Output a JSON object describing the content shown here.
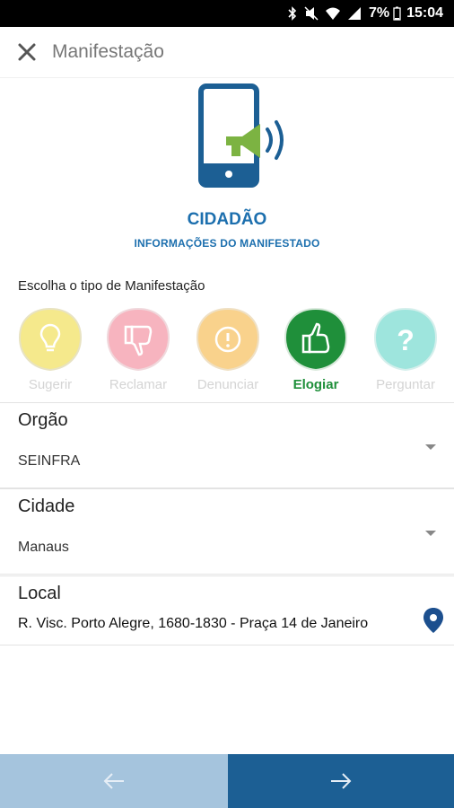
{
  "statusbar": {
    "battery": "7%",
    "time": "15:04"
  },
  "appbar": {
    "title": "Manifestação"
  },
  "hero": {
    "title": "CIDADÃO",
    "subtitle": "INFORMAÇÕES DO MANIFESTADO"
  },
  "types": {
    "prompt": "Escolha o tipo de Manifestação",
    "items": [
      {
        "label": "Sugerir",
        "icon": "lightbulb-icon",
        "color": "#f5e98c",
        "selected": false
      },
      {
        "label": "Reclamar",
        "icon": "thumbs-down-icon",
        "color": "#f7b4bf",
        "selected": false
      },
      {
        "label": "Denunciar",
        "icon": "exclamation-icon",
        "color": "#f9d28c",
        "selected": false
      },
      {
        "label": "Elogiar",
        "icon": "thumbs-up-icon",
        "color": "#1f8f3a",
        "selected": true
      },
      {
        "label": "Perguntar",
        "icon": "question-icon",
        "color": "#9ee5dd",
        "selected": false
      }
    ]
  },
  "orgao": {
    "label": "Orgão",
    "value": "SEINFRA"
  },
  "cidade": {
    "label": "Cidade",
    "value": "Manaus"
  },
  "local": {
    "label": "Local",
    "value": "R. Visc. Porto Alegre, 1680-1830 - Praça 14 de Janeiro"
  },
  "colors": {
    "primary": "#1c5f94",
    "accent": "#1c6fae",
    "prev_bg": "#a5c4dd",
    "megaphone": "#7cb342"
  }
}
